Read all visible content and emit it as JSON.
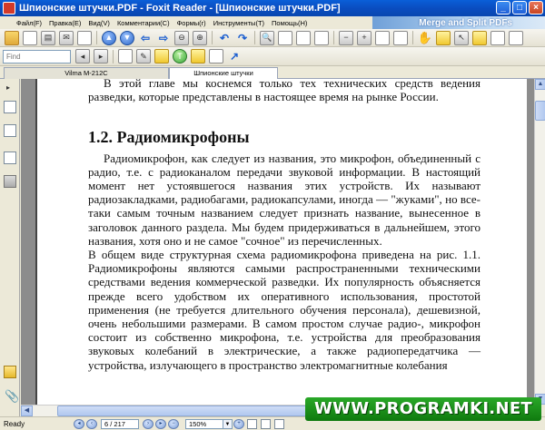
{
  "window": {
    "title": "Шпионские штучки.PDF - Foxit Reader - [Шпионские штучки.PDF]"
  },
  "menu": {
    "items": [
      "Файл(F)",
      "Правка(E)",
      "Вид(V)",
      "Комментарии(C)",
      "Формы(r)",
      "Инструменты(T)",
      "Помощь(H)"
    ],
    "banner": "Merge and Split PDFs"
  },
  "toolbar2": {
    "find_placeholder": "Find"
  },
  "tabs": [
    {
      "label": "Vilma M-212C"
    },
    {
      "label": "Шпионские штучки"
    }
  ],
  "document": {
    "para_top": "В этой главе мы коснемся только тех технических средств ведения разведки, которые представлены в настоящее время на рынке России.",
    "heading": "1.2. Радиомикрофоны",
    "para1": "Радиомикрофон, как следует из названия, это микрофон, объединенный с радио, т.е. с радиоканалом передачи звуковой информации. В настоящий момент нет устоявшегося названия этих устройств. Их называют радиозакладками, радиобагами, радиокапсулами, иногда — \"жуками\", но все-таки самым точным названием следует признать название, вынесенное в заголовок данного раздела. Мы будем придерживаться в дальнейшем, этого названия, хотя оно и не самое \"сочное\" из перечисленных.",
    "para2": "В общем виде структурная схема радиомикрофона приведена на рис. 1.1. Радиомикрофоны являются самыми распространенными техническими средствами ведения коммерческой разведки. Их популярность объясняется прежде всего удобством их оперативного использования, простотой применения (не требуется длительного обучения персонала), дешевизной, очень небольшими размерами. В самом простом случае радио-, микрофон состоит из собственно микрофона, т.е. устройства для преобразования звуковых колебаний в электрические, а также радиопередатчика — устройства, излучающего в пространство электромагнитные колебания"
  },
  "status": {
    "text": "Ready",
    "page_value": "6 / 217",
    "zoom_value": "150%"
  },
  "watermark": "WWW.PROGRAMKI.NET"
}
